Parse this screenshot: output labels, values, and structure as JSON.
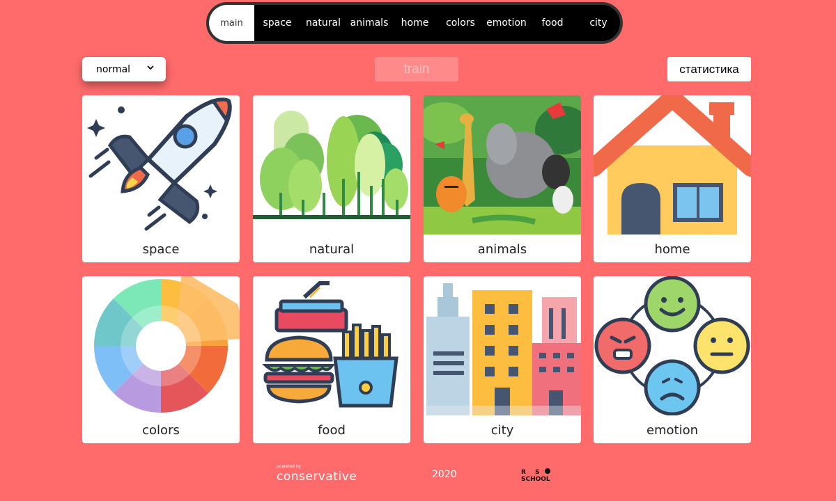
{
  "nav": {
    "items": [
      {
        "label": "main",
        "active": true
      },
      {
        "label": "space"
      },
      {
        "label": "natural"
      },
      {
        "label": "animals"
      },
      {
        "label": "home"
      },
      {
        "label": "colors"
      },
      {
        "label": "emotion"
      },
      {
        "label": "food"
      },
      {
        "label": "city"
      }
    ]
  },
  "controls": {
    "mode_value": "normal",
    "train_label": "train",
    "stats_label": "статистика"
  },
  "cards": [
    {
      "label": "space",
      "icon": "rocket-icon"
    },
    {
      "label": "natural",
      "icon": "trees-icon"
    },
    {
      "label": "animals",
      "icon": "jungle-animals-icon"
    },
    {
      "label": "home",
      "icon": "house-icon"
    },
    {
      "label": "colors",
      "icon": "color-wheel-icon"
    },
    {
      "label": "food",
      "icon": "fast-food-icon"
    },
    {
      "label": "city",
      "icon": "buildings-icon"
    },
    {
      "label": "emotion",
      "icon": "emoji-faces-icon"
    }
  ],
  "footer": {
    "powered_small": "powered by",
    "powered_brand": "conservative",
    "year": "2020",
    "logo_icon": "rs-school-logo-icon"
  },
  "colors": {
    "background": "#ff6b6b",
    "nav_bg": "#000000",
    "card_bg": "#ffffff"
  }
}
